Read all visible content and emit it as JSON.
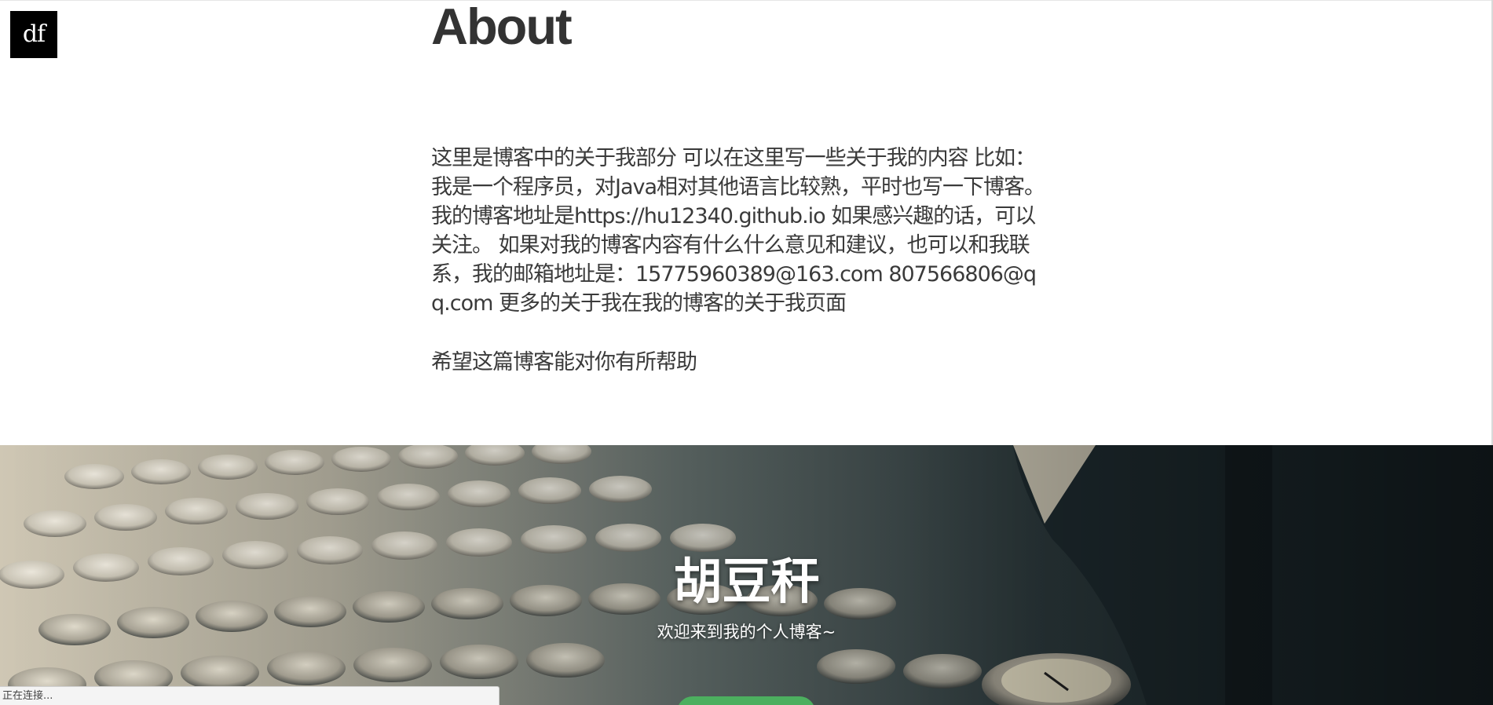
{
  "header": {
    "logo_text": "df"
  },
  "about": {
    "title": "About",
    "body": "这里是博客中的关于我部分 可以在这里写一些关于我的内容 比如： 我是一个程序员，对Java相对其他语言比较熟，平时也写一下博客。我的博客地址是https://hu12340.github.io 如果感兴趣的话，可以关注。 如果对我的博客内容有什么什么意见和建议，也可以和我联系，我的邮箱地址是：15775960389@163.com 807566806@qq.com 更多的关于我在我的博客的关于我页面",
    "closing": "希望这篇博客能对你有所帮助"
  },
  "hero": {
    "title": "胡豆秆",
    "subtitle": "欢迎来到我的个人博客~",
    "button_color": "#4caf5f"
  },
  "status": {
    "text": "正在连接..."
  }
}
